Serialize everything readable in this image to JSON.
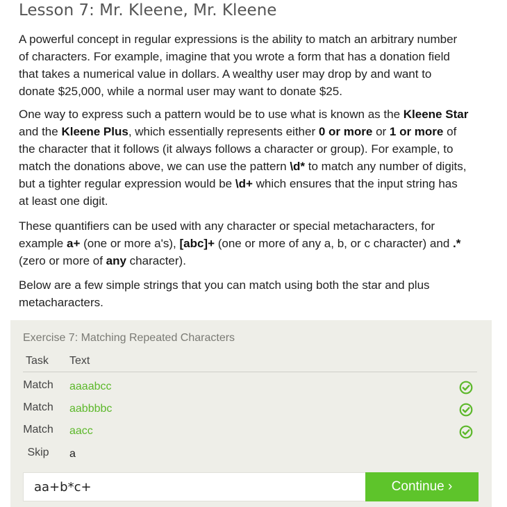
{
  "lesson": {
    "title": "Lesson 7: Mr. Kleene, Mr. Kleene",
    "p1": "A powerful concept in regular expressions is the ability to match an arbitrary number of characters. For example, imagine that you wrote a form that has a donation field that takes a numerical value in dollars. A wealthy user may drop by and want to donate $25,000, while a normal user may want to donate $25.",
    "p2": {
      "t1": "One way to express such a pattern would be to use what is known as the ",
      "b1": "Kleene Star",
      "t2": " and the ",
      "b2": "Kleene Plus",
      "t3": ", which essentially represents either ",
      "b3": "0 or more",
      "t4": " or ",
      "b4": "1 or more",
      "t5": " of the character that it follows (it always follows a character or group). For example, to match the donations above, we can use the pattern ",
      "b5": "\\d*",
      "t6": " to match any number of digits, but a tighter regular expression would be ",
      "b6": "\\d+",
      "t7": " which ensures that the input string has at least one digit."
    },
    "p3": {
      "t1": "These quantifiers can be used with any character or special metacharacters, for example ",
      "b1": "a+",
      "t2": " (one or more a's), ",
      "b2": "[abc]+",
      "t3": " (one or more of any a, b, or c character) and ",
      "b3": ".*",
      "t4": " (zero or more of ",
      "b4": "any",
      "t5": " character)."
    },
    "p4": "Below are a few simple strings that you can match using both the star and plus metacharacters."
  },
  "exercise": {
    "title": "Exercise 7: Matching Repeated Characters",
    "col_task": "Task",
    "col_text": "Text",
    "rows": [
      {
        "task": "Match",
        "text": "aaaabcc",
        "status_icon": "check-circle-icon"
      },
      {
        "task": "Match",
        "text": "aabbbbc",
        "status_icon": "check-circle-icon"
      },
      {
        "task": "Match",
        "text": "aacc",
        "status_icon": "check-circle-icon"
      },
      {
        "task": "Skip",
        "text": "a",
        "status_icon": ""
      }
    ],
    "answer_value": "aa+b*c+",
    "continue_label": "Continue ›"
  },
  "colors": {
    "accent_green": "#5ec42b",
    "match_text_green": "#5cb82a",
    "panel_bg": "#eeeee8"
  }
}
